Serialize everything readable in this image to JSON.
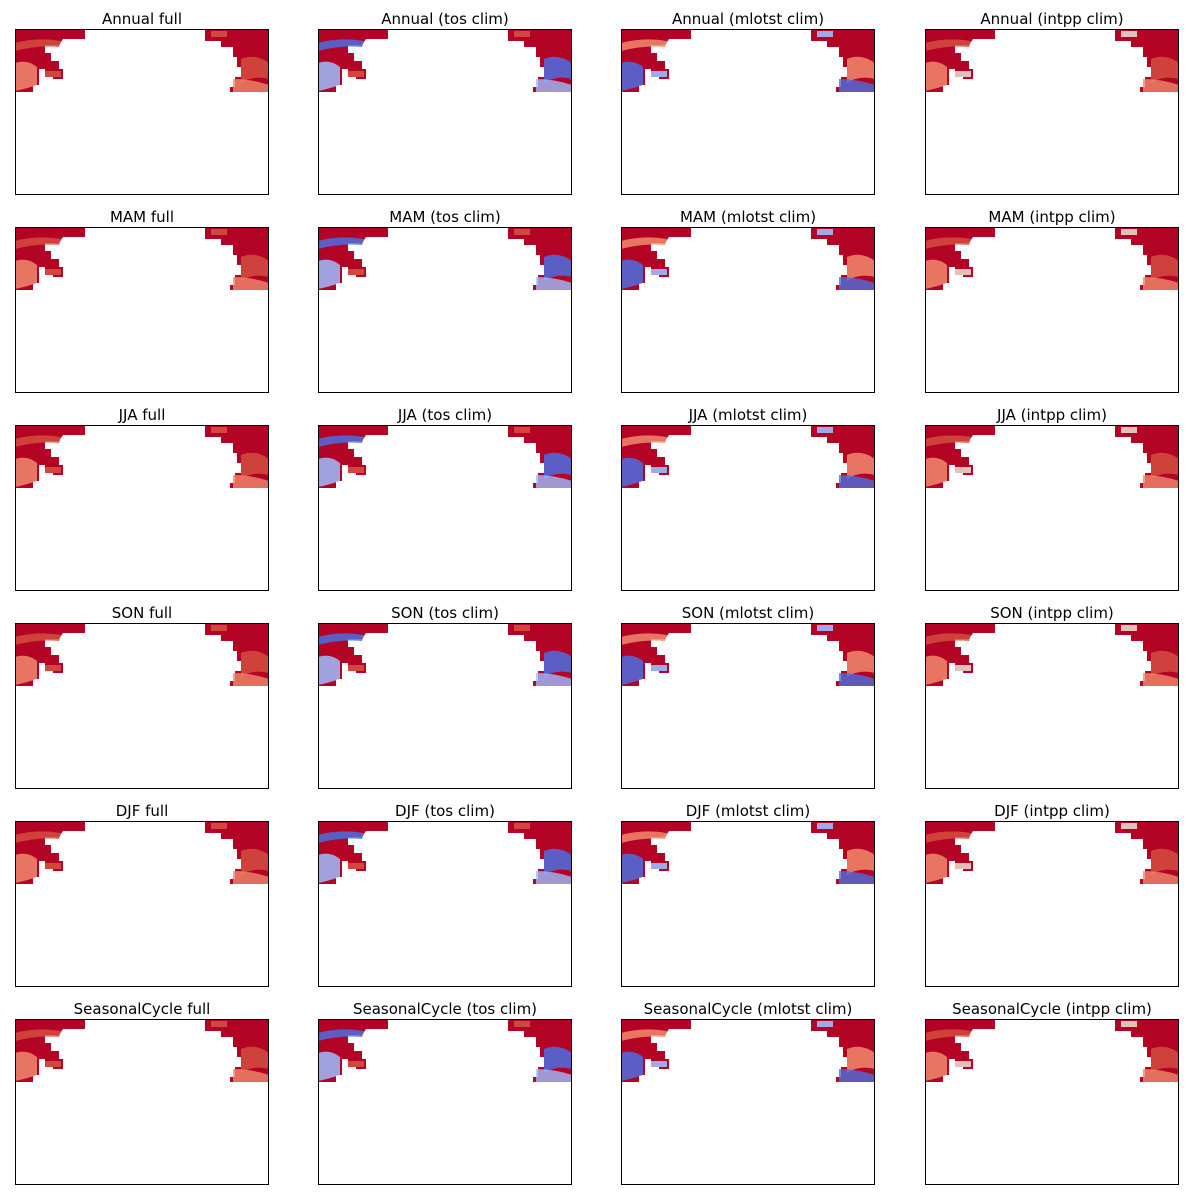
{
  "figure": {
    "background": "#ffffff"
  },
  "chart_data": {
    "type": "heatmap",
    "colormap": "coolwarm",
    "colors": {
      "strong_red": "#b40426",
      "red": "#d44e41",
      "light_red": "#f08a6c",
      "pale": "#e8d6cc",
      "light_blue": "#9dbdff",
      "blue": "#4b6fe0",
      "frame": "#000000"
    },
    "rows": [
      "Annual",
      "MAM",
      "JJA",
      "SON",
      "DJF",
      "SeasonalCycle"
    ],
    "columns": [
      "full",
      "(tos clim)",
      "(mlotst clim)",
      "(intpp clim)"
    ],
    "panels": [
      [
        {
          "title": "Annual full",
          "pattern": "full"
        },
        {
          "title": "Annual (tos clim)",
          "pattern": "tos"
        },
        {
          "title": "Annual (mlotst clim)",
          "pattern": "mlotst"
        },
        {
          "title": "Annual (intpp clim)",
          "pattern": "intpp"
        }
      ],
      [
        {
          "title": "MAM full",
          "pattern": "full"
        },
        {
          "title": "MAM (tos clim)",
          "pattern": "tos"
        },
        {
          "title": "MAM (mlotst clim)",
          "pattern": "mlotst"
        },
        {
          "title": "MAM (intpp clim)",
          "pattern": "intpp"
        }
      ],
      [
        {
          "title": "JJA full",
          "pattern": "full"
        },
        {
          "title": "JJA (tos clim)",
          "pattern": "tos"
        },
        {
          "title": "JJA (mlotst clim)",
          "pattern": "mlotst"
        },
        {
          "title": "JJA (intpp clim)",
          "pattern": "intpp"
        }
      ],
      [
        {
          "title": "SON full",
          "pattern": "full"
        },
        {
          "title": "SON (tos clim)",
          "pattern": "tos"
        },
        {
          "title": "SON (mlotst clim)",
          "pattern": "mlotst"
        },
        {
          "title": "SON (intpp clim)",
          "pattern": "intpp"
        }
      ],
      [
        {
          "title": "DJF full",
          "pattern": "full"
        },
        {
          "title": "DJF (tos clim)",
          "pattern": "tos"
        },
        {
          "title": "DJF (mlotst clim)",
          "pattern": "mlotst"
        },
        {
          "title": "DJF (intpp clim)",
          "pattern": "intpp"
        }
      ],
      [
        {
          "title": "SeasonalCycle full",
          "pattern": "full"
        },
        {
          "title": "SeasonalCycle (tos clim)",
          "pattern": "tos"
        },
        {
          "title": "SeasonalCycle (mlotst clim)",
          "pattern": "mlotst"
        },
        {
          "title": "SeasonalCycle (intpp clim)",
          "pattern": "intpp"
        }
      ]
    ]
  }
}
